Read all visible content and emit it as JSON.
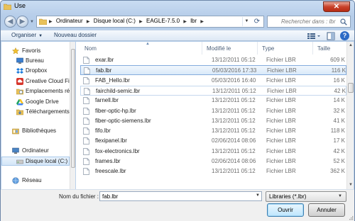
{
  "window": {
    "title": "Use",
    "close_label": "✕"
  },
  "address": {
    "crumbs": [
      "Ordinateur",
      "Disque local (C:)",
      "EAGLE-7.5.0",
      "lbr"
    ],
    "search_placeholder": "Rechercher dans : lbr"
  },
  "toolbar": {
    "organize_label": "Organiser",
    "new_folder_label": "Nouveau dossier",
    "help_label": "?"
  },
  "nav": {
    "items": [
      {
        "label": "Favoris",
        "icon": "star-icon"
      },
      {
        "label": "Bureau",
        "icon": "desktop-icon"
      },
      {
        "label": "Dropbox",
        "icon": "dropbox-icon"
      },
      {
        "label": "Creative Cloud Fil",
        "icon": "creative-cloud-icon"
      },
      {
        "label": "Emplacements ré",
        "icon": "recent-places-icon"
      },
      {
        "label": "Google Drive",
        "icon": "google-drive-icon"
      },
      {
        "label": "Téléchargements",
        "icon": "downloads-icon"
      },
      {
        "label": "Bibliothèques",
        "icon": "libraries-icon"
      },
      {
        "label": "Ordinateur",
        "icon": "computer-icon"
      },
      {
        "label": "Disque local (C:)",
        "icon": "drive-icon"
      },
      {
        "label": "Réseau",
        "icon": "network-icon"
      }
    ]
  },
  "columns": {
    "name": "Nom",
    "date": "Modifié le",
    "type": "Type",
    "size": "Taille"
  },
  "files": [
    {
      "name": "exar.lbr",
      "date": "13/12/2011 05:12",
      "type": "Fichier LBR",
      "size": "609 K"
    },
    {
      "name": "fab.lbr",
      "date": "05/03/2016 17:33",
      "type": "Fichier LBR",
      "size": "116 K"
    },
    {
      "name": "FAB_Hello.lbr",
      "date": "05/03/2016 16:40",
      "type": "Fichier LBR",
      "size": "16 K"
    },
    {
      "name": "fairchild-semic.lbr",
      "date": "13/12/2011 05:12",
      "type": "Fichier LBR",
      "size": "42 K"
    },
    {
      "name": "farnell.lbr",
      "date": "13/12/2011 05:12",
      "type": "Fichier LBR",
      "size": "14 K"
    },
    {
      "name": "fiber-optic-hp.lbr",
      "date": "13/12/2011 05:12",
      "type": "Fichier LBR",
      "size": "32 K"
    },
    {
      "name": "fiber-optic-siemens.lbr",
      "date": "13/12/2011 05:12",
      "type": "Fichier LBR",
      "size": "41 K"
    },
    {
      "name": "fifo.lbr",
      "date": "13/12/2011 05:12",
      "type": "Fichier LBR",
      "size": "118 K"
    },
    {
      "name": "flexipanel.lbr",
      "date": "02/06/2014 08:06",
      "type": "Fichier LBR",
      "size": "17 K"
    },
    {
      "name": "fox-electronics.lbr",
      "date": "13/12/2011 05:12",
      "type": "Fichier LBR",
      "size": "42 K"
    },
    {
      "name": "frames.lbr",
      "date": "02/06/2014 08:06",
      "type": "Fichier LBR",
      "size": "52 K"
    },
    {
      "name": "freescale.lbr",
      "date": "13/12/2011 05:12",
      "type": "Fichier LBR",
      "size": "362 K"
    }
  ],
  "selected_file_index": 1,
  "bottom": {
    "filename_label": "Nom du fichier :",
    "filename_value": "fab.lbr",
    "filter_value": "Libraries (*.lbr)",
    "open_label": "Ouvrir",
    "cancel_label": "Annuler"
  },
  "colors": {
    "selection": "#d9e9f9",
    "selection_border": "#84acdd",
    "accent": "#2d6bc6"
  }
}
